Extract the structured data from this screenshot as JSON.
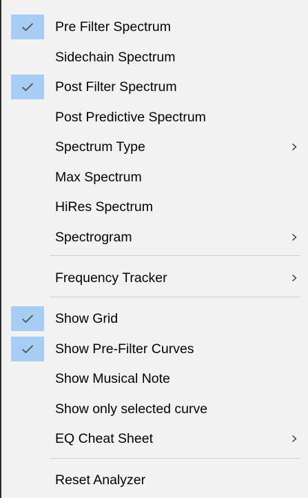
{
  "menu": {
    "accent": "#a8cdf5",
    "items": [
      {
        "label": "Pre Filter Spectrum",
        "checked": true,
        "submenu": false,
        "icon": "check-icon"
      },
      {
        "label": "Sidechain Spectrum",
        "checked": false,
        "submenu": false
      },
      {
        "label": "Post Filter Spectrum",
        "checked": true,
        "submenu": false,
        "icon": "check-icon"
      },
      {
        "label": "Post Predictive Spectrum",
        "checked": false,
        "submenu": false
      },
      {
        "label": "Spectrum Type",
        "checked": false,
        "submenu": true,
        "icon": "chevron-right-icon"
      },
      {
        "label": "Max Spectrum",
        "checked": false,
        "submenu": false
      },
      {
        "label": "HiRes Spectrum",
        "checked": false,
        "submenu": false
      },
      {
        "label": "Spectrogram",
        "checked": false,
        "submenu": true,
        "icon": "chevron-right-icon"
      },
      {
        "label": "Frequency Tracker",
        "checked": false,
        "submenu": true,
        "icon": "chevron-right-icon"
      },
      {
        "label": "Show Grid",
        "checked": true,
        "submenu": false,
        "icon": "check-icon"
      },
      {
        "label": "Show Pre-Filter Curves",
        "checked": true,
        "submenu": false,
        "icon": "check-icon"
      },
      {
        "label": "Show Musical Note",
        "checked": false,
        "submenu": false
      },
      {
        "label": "Show only selected curve",
        "checked": false,
        "submenu": false
      },
      {
        "label": "EQ Cheat Sheet",
        "checked": false,
        "submenu": true,
        "icon": "chevron-right-icon"
      },
      {
        "label": "Reset Analyzer",
        "checked": false,
        "submenu": false
      }
    ]
  }
}
